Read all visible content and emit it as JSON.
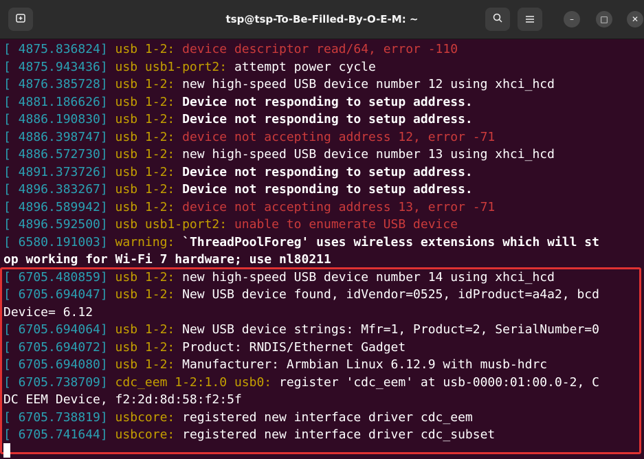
{
  "window": {
    "title": "tsp@tsp-To-Be-Filled-By-O-E-M: ~",
    "new_tab_icon": "new-tab-icon",
    "search_icon": "search-icon",
    "menu_icon": "hamburger-menu-icon",
    "minimize_glyph": "–",
    "maximize_glyph": "□",
    "close_glyph": "✕"
  },
  "colors": {
    "background": "#300a24",
    "timestamp": "#2aa1b3",
    "device": "#c4a000",
    "error": "#cc3b3b",
    "text": "#ffffff",
    "highlight_border": "#e03232"
  },
  "lines": [
    {
      "ts": "[ 4875.836824]",
      "dev": " usb 1-2:",
      "msg": " device descriptor read/64, error -110",
      "style": "err"
    },
    {
      "ts": "[ 4875.943436]",
      "dev": " usb usb1-port2:",
      "msg": " attempt power cycle",
      "style": ""
    },
    {
      "ts": "[ 4876.385728]",
      "dev": " usb 1-2:",
      "msg": " new high-speed USB device number 12 using xhci_hcd",
      "style": ""
    },
    {
      "ts": "[ 4881.186626]",
      "dev": " usb 1-2:",
      "msg": " Device not responding to setup address.",
      "style": "bold"
    },
    {
      "ts": "[ 4886.190830]",
      "dev": " usb 1-2:",
      "msg": " Device not responding to setup address.",
      "style": "bold"
    },
    {
      "ts": "[ 4886.398747]",
      "dev": " usb 1-2:",
      "msg": " device not accepting address 12, error -71",
      "style": "err"
    },
    {
      "ts": "[ 4886.572730]",
      "dev": " usb 1-2:",
      "msg": " new high-speed USB device number 13 using xhci_hcd",
      "style": ""
    },
    {
      "ts": "[ 4891.373726]",
      "dev": " usb 1-2:",
      "msg": " Device not responding to setup address.",
      "style": "bold"
    },
    {
      "ts": "[ 4896.383267]",
      "dev": " usb 1-2:",
      "msg": " Device not responding to setup address.",
      "style": "bold"
    },
    {
      "ts": "[ 4896.589942]",
      "dev": " usb 1-2:",
      "msg": " device not accepting address 13, error -71",
      "style": "err"
    },
    {
      "ts": "[ 4896.592500]",
      "dev": " usb usb1-port2:",
      "msg": " unable to enumerate USB device",
      "style": "err"
    },
    {
      "ts": "[ 6580.191003]",
      "dev": " warning:",
      "msg": " `ThreadPoolForeg' uses wireless extensions which will st",
      "style": "bold"
    },
    {
      "ts": "",
      "dev": "",
      "msg": "op working for Wi-Fi 7 hardware; use nl80211",
      "style": "bold"
    },
    {
      "ts": "[ 6705.480859]",
      "dev": " usb 1-2:",
      "msg": " new high-speed USB device number 14 using xhci_hcd",
      "style": ""
    },
    {
      "ts": "[ 6705.694047]",
      "dev": " usb 1-2:",
      "msg": " New USB device found, idVendor=0525, idProduct=a4a2, bcd",
      "style": ""
    },
    {
      "ts": "",
      "dev": "",
      "msg": "Device= 6.12",
      "style": ""
    },
    {
      "ts": "[ 6705.694064]",
      "dev": " usb 1-2:",
      "msg": " New USB device strings: Mfr=1, Product=2, SerialNumber=0",
      "style": ""
    },
    {
      "ts": "[ 6705.694072]",
      "dev": " usb 1-2:",
      "msg": " Product: RNDIS/Ethernet Gadget",
      "style": ""
    },
    {
      "ts": "[ 6705.694080]",
      "dev": " usb 1-2:",
      "msg": " Manufacturer: Armbian Linux 6.12.9 with musb-hdrc",
      "style": ""
    },
    {
      "ts": "[ 6705.738709]",
      "dev": " cdc_eem 1-2:1.0 usb0:",
      "msg": " register 'cdc_eem' at usb-0000:01:00.0-2, C",
      "style": ""
    },
    {
      "ts": "",
      "dev": "",
      "msg": "DC EEM Device, f2:2d:8d:58:f2:5f",
      "style": ""
    },
    {
      "ts": "[ 6705.738819]",
      "dev": " usbcore:",
      "msg": " registered new interface driver cdc_eem",
      "style": ""
    },
    {
      "ts": "[ 6705.741644]",
      "dev": " usbcore:",
      "msg": " registered new interface driver cdc_subset",
      "style": ""
    }
  ]
}
